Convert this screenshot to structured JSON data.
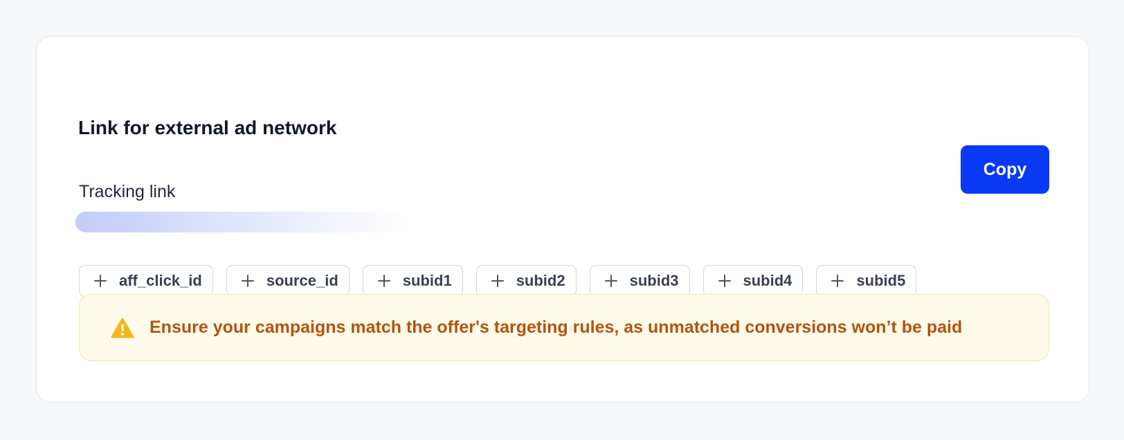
{
  "card": {
    "title": "Link for external ad network"
  },
  "tracking": {
    "label": "Tracking link",
    "copy_label": "Copy"
  },
  "parameters": [
    {
      "label": "aff_click_id"
    },
    {
      "label": "source_id"
    },
    {
      "label": "subid1"
    },
    {
      "label": "subid2"
    },
    {
      "label": "subid3"
    },
    {
      "label": "subid4"
    },
    {
      "label": "subid5"
    }
  ],
  "alert": {
    "icon": "warning-icon",
    "text": "Ensure your campaigns match the offer's targeting rules, as unmatched conversions won’t be paid"
  },
  "colors": {
    "accent": "#0a39f6",
    "warning_text": "#b4530f",
    "warning_bg": "#fefbea",
    "warning_icon": "#f5b81c"
  }
}
